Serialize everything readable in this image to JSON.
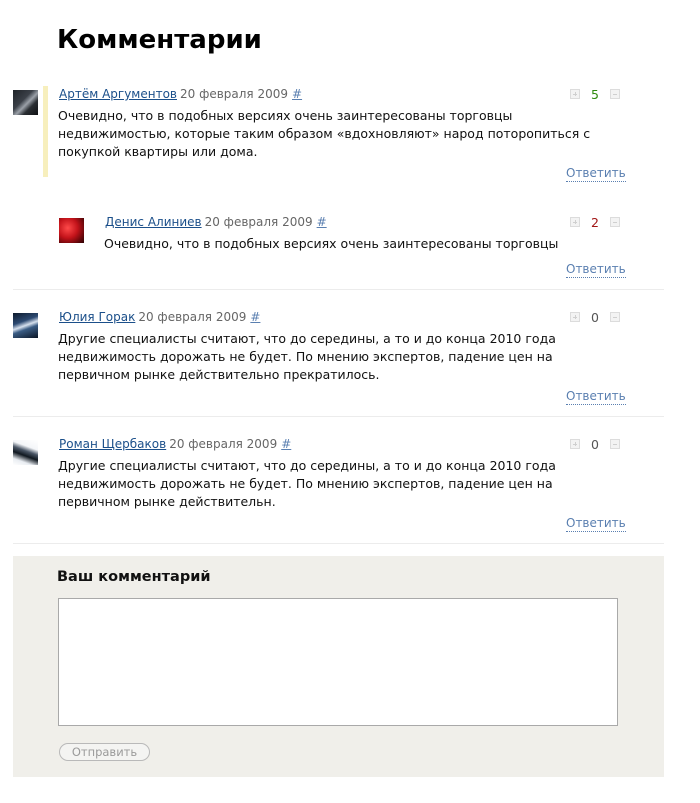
{
  "page": {
    "title": "Комментарии"
  },
  "comments": [
    {
      "author": "Артём Аргументов",
      "date": "20 февраля 2009",
      "anchor": "#",
      "text": "Очевидно, что в подобных версиях очень заинтересованы торговцы недвижимостью, которые таким образом «вдохновляют» народ поторопиться с покупкой квартиры или дома.",
      "rating": "5",
      "rating_color": "#2e8a0e",
      "reply_label": "Ответить",
      "highlighted": true,
      "avatar_icon": "avatar-dark-car-icon"
    },
    {
      "author": "Денис Алиниев",
      "date": "20 февраля 2009",
      "anchor": "#",
      "text": "Очевидно, что в подобных версиях очень заинтересованы торговцы",
      "rating": "2",
      "rating_color": "#a11616",
      "reply_label": "Ответить",
      "reply_level": 1,
      "avatar_icon": "avatar-red-car-icon"
    },
    {
      "author": "Юлия Горак",
      "date": "20 февраля 2009",
      "anchor": "#",
      "text": "Другие специалисты считают, что до середины, а то и до конца 2010 года недвижимость дорожать не будет. По мнению экспертов, падение цен на первичном рынке действительно прекратилось.",
      "rating": "0",
      "rating_color": "#555555",
      "reply_label": "Ответить",
      "avatar_icon": "avatar-blue-car-icon"
    },
    {
      "author": "Роман Щербаков",
      "date": "20 февраля 2009",
      "anchor": "#",
      "text": "Другие специалисты считают, что до середины, а то и до конца 2010 года недвижимость дорожать не будет. По мнению экспертов, падение цен на первичном рынке действительн.",
      "rating": "0",
      "rating_color": "#555555",
      "reply_label": "Ответить",
      "avatar_icon": "avatar-white-car-icon"
    }
  ],
  "form": {
    "title": "Ваш комментарий",
    "textarea_value": "",
    "submit_label": "Отправить"
  },
  "colors": {
    "link": "#1b4f8a",
    "highlight_bar": "#f7efbd",
    "form_background": "#f0efea"
  }
}
